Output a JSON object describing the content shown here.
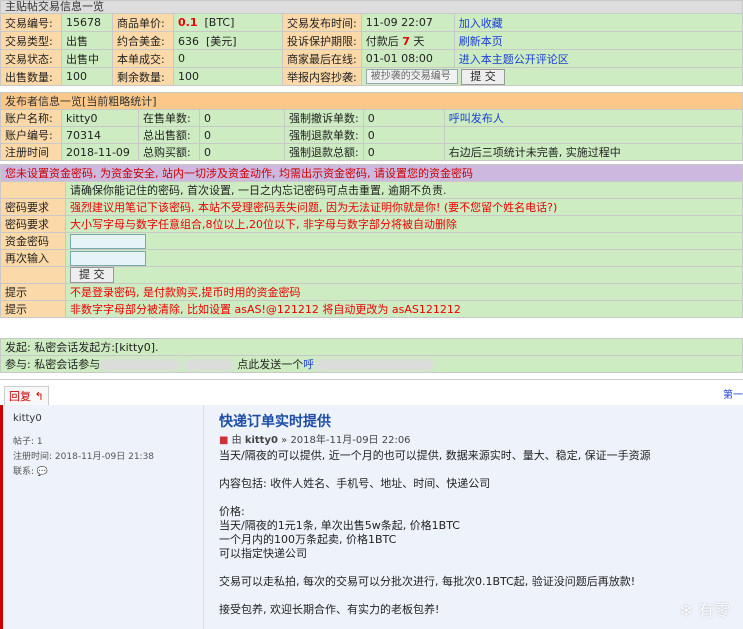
{
  "trade": {
    "header": "主贴帖交易信息一览",
    "row1": {
      "label_id": "交易编号:",
      "id": "15678",
      "label_price": "商品单价:",
      "price": "0.1",
      "price_unit": "[BTC]",
      "label_time": "交易发布时间:",
      "time": "11-09 22:07",
      "action": "加入收藏"
    },
    "row2": {
      "label_type": "交易类型:",
      "type": "出售",
      "label_usd": "约合美金:",
      "usd": "636",
      "usd_unit": "[美元]",
      "label_protect": "投诉保护期限:",
      "protect_pre": "付款后",
      "protect_days": "7",
      "protect_post": "天",
      "action": "刷新本页"
    },
    "row3": {
      "label_status": "交易状态:",
      "status": "出售中",
      "label_done": "本单成交:",
      "done": "0",
      "label_seller_online": "商家最后在线:",
      "seller_online": "01-01 08:00",
      "action": "进入本主题公开评论区"
    },
    "row4": {
      "label_qty": "出售数量:",
      "qty": "100",
      "label_left": "剩余数量:",
      "left": "100",
      "label_report": "举报内容抄袭:",
      "report_placeholder": "被抄袭的交易编号",
      "submit": "提 交"
    }
  },
  "publisher": {
    "header": "发布者信息一览[当前粗略统计]",
    "r1": {
      "l1": "账户名称:",
      "v1": "kitty0",
      "l2": "在售单数:",
      "v2": "0",
      "l3": "强制撤诉单数:",
      "v3": "0",
      "action": "呼叫发布人"
    },
    "r2": {
      "l1": "账户编号:",
      "v1": "70314",
      "l2": "总出售额:",
      "v2": "0",
      "l3": "强制退款单数:",
      "v3": "0"
    },
    "r3": {
      "l1": "注册时间",
      "v1": "2018-11-09",
      "l2": "总购买额:",
      "v2": "0",
      "l3": "强制退款总额:",
      "v3": "0",
      "note": "右边后三项统计未完善, 实施过程中"
    }
  },
  "password": {
    "warn": "您未设置资金密码, 为资金安全, 站内一切涉及资金动作, 均需出示资金密码, 请设置您的资金密码",
    "notice": "请确保你能记住的密码, 首次设置, 一日之内忘记密码可点击重置, 逾期不负责.",
    "req_label": "密码要求",
    "req1": "强烈建议用笔记下该密码, 本站不受理密码丢失问题, 因为无法证明你就是你! (要不您留个姓名电话?)",
    "req2": "大小写字母与数字任意组合,8位以上,20位以下, 非字母与数字部分将被自动删除",
    "fund_label": "资金密码",
    "again_label": "再次输入",
    "submit": "提 交",
    "tip_label": "提示",
    "tip1": "不是登录密码, 是付款购买,提币时用的资金密码",
    "tip2": "非数字字母部分被清除, 比如设置 asAS!@121212 将自动更改为 asAS121212"
  },
  "chat": {
    "line1": "发起: 私密会话发起方:[kitty0].",
    "line2_pre": "参与: 私密会话参与",
    "line2_mid": "点此发送一个",
    "line2_link": "呼"
  },
  "postbar": {
    "reply": "回复",
    "page": "第一"
  },
  "post": {
    "username": "kitty0",
    "posts_label": "帖子:",
    "posts": "1",
    "reg_label": "注册时间:",
    "reg": "2018-11月-09日 21:38",
    "contact_label": "联系:",
    "title": "快递订单实时提供",
    "meta_by": "由",
    "meta_user": "kitty0",
    "meta_time": "» 2018年-11月-09日 22:06",
    "lines": [
      "当天/隔夜的可以提供, 近一个月的也可以提供, 数据来源实时、量大、稳定, 保证一手资源",
      "",
      "内容包括: 收件人姓名、手机号、地址、时间、快递公司",
      "",
      "价格:",
      "当天/隔夜的1元1条, 单次出售5w条起, 价格1BTC",
      "一个月内的100万条起卖, 价格1BTC",
      "可以指定快递公司",
      "",
      "交易可以走私拍, 每次的交易可以分批次进行, 每批次0.1BTC起, 验证没问题后再放款!",
      "",
      "接受包养, 欢迎长期合作、有实力的老板包养!"
    ],
    "watermark": "❄ 有零"
  }
}
